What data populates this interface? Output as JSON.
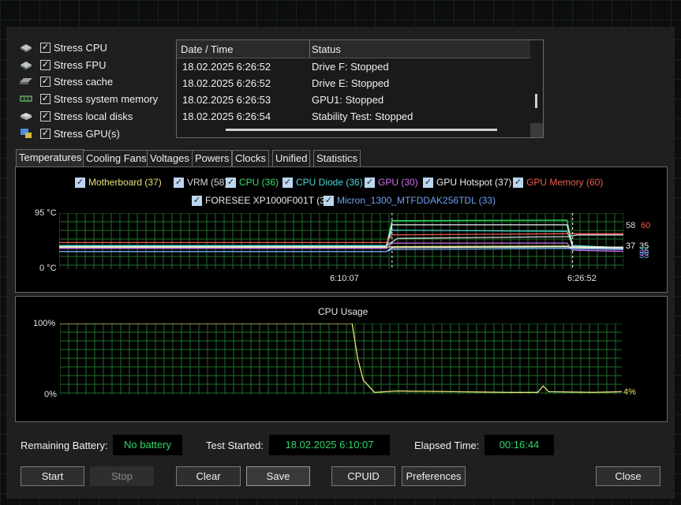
{
  "stress_options": [
    {
      "label": "Stress CPU",
      "checked": true,
      "icon": "cpu-icon"
    },
    {
      "label": "Stress FPU",
      "checked": true,
      "icon": "fpu-icon"
    },
    {
      "label": "Stress cache",
      "checked": true,
      "icon": "cache-icon"
    },
    {
      "label": "Stress system memory",
      "checked": true,
      "icon": "memory-icon"
    },
    {
      "label": "Stress local disks",
      "checked": true,
      "icon": "disk-icon"
    },
    {
      "label": "Stress GPU(s)",
      "checked": true,
      "icon": "gpu-icon"
    }
  ],
  "log": {
    "columns": [
      "Date / Time",
      "Status"
    ],
    "rows": [
      {
        "time": "18.02.2025 6:26:52",
        "status": "Drive F: Stopped"
      },
      {
        "time": "18.02.2025 6:26:52",
        "status": "Drive E: Stopped"
      },
      {
        "time": "18.02.2025 6:26:53",
        "status": "GPU1: Stopped"
      },
      {
        "time": "18.02.2025 6:26:54",
        "status": "Stability Test: Stopped"
      }
    ]
  },
  "tabs": [
    "Temperatures",
    "Cooling Fans",
    "Voltages",
    "Powers",
    "Clocks",
    "Unified",
    "Statistics"
  ],
  "temperature_legend": [
    {
      "label": "Motherboard (37)",
      "color": "#e8e27a"
    },
    {
      "label": "VRM (58)",
      "color": "#d9d9d9"
    },
    {
      "label": "CPU (36)",
      "color": "#33e06a"
    },
    {
      "label": "CPU Diode (36)",
      "color": "#4ad8d8"
    },
    {
      "label": "GPU (30)",
      "color": "#d070f0"
    },
    {
      "label": "GPU Hotspot (37)",
      "color": "#f0f0f0"
    },
    {
      "label": "GPU Memory (60)",
      "color": "#f05a50"
    },
    {
      "label": "FORESEE XP1000F001T (35)",
      "color": "#ececec"
    },
    {
      "label": "Micron_1300_MTFDDAK256TDL (33)",
      "color": "#6fa0f0"
    }
  ],
  "chart_data": [
    {
      "type": "line",
      "title": "",
      "ylabel": "",
      "ylim": [
        0,
        95
      ],
      "ytick_labels": [
        "95 °C",
        "0 °C"
      ],
      "xtick_labels": [
        "6:10:07",
        "6:26:52"
      ],
      "end_labels": [
        {
          "text": "58",
          "color": "#d9d9d9"
        },
        {
          "text": "60",
          "color": "#f05a50"
        },
        {
          "text": "37",
          "color": "#f0f0f0"
        },
        {
          "text": "35",
          "color": "#ececec"
        },
        {
          "text": "36",
          "color": "#4ad8d8"
        },
        {
          "text": "30",
          "color": "#d070f0"
        },
        {
          "text": "33",
          "color": "#6fa0f0"
        }
      ],
      "series": [
        {
          "name": "Motherboard",
          "color": "#e8e27a",
          "x": [
            0,
            0.58,
            0.59,
            0.9,
            0.91,
            1
          ],
          "y": [
            37,
            37,
            38,
            39,
            37,
            37
          ]
        },
        {
          "name": "VRM",
          "color": "#d9d9d9",
          "x": [
            0,
            0.58,
            0.6,
            0.9,
            0.92,
            1
          ],
          "y": [
            40,
            40,
            52,
            55,
            58,
            58
          ]
        },
        {
          "name": "CPU",
          "color": "#33e06a",
          "x": [
            0,
            0.58,
            0.59,
            0.9,
            0.91,
            1
          ],
          "y": [
            40,
            40,
            82,
            83,
            40,
            36
          ]
        },
        {
          "name": "CPU Diode",
          "color": "#4ad8d8",
          "x": [
            0,
            0.58,
            0.59,
            0.9,
            0.91,
            1
          ],
          "y": [
            40,
            40,
            66,
            64,
            40,
            36
          ]
        },
        {
          "name": "GPU",
          "color": "#d070f0",
          "x": [
            0,
            0.58,
            0.59,
            0.9,
            0.91,
            1
          ],
          "y": [
            35,
            35,
            44,
            44,
            32,
            30
          ]
        },
        {
          "name": "GPU Hotspot",
          "color": "#f0f0f0",
          "x": [
            0,
            0.58,
            0.59,
            0.9,
            0.91,
            1
          ],
          "y": [
            38,
            38,
            75,
            75,
            38,
            37
          ]
        },
        {
          "name": "GPU Memory",
          "color": "#f05a50",
          "x": [
            0,
            0.58,
            0.59,
            0.9,
            0.91,
            1
          ],
          "y": [
            45,
            45,
            58,
            60,
            60,
            60
          ]
        },
        {
          "name": "FORESEE XP1000F001T",
          "color": "#ececec",
          "x": [
            0,
            0.58,
            0.59,
            0.9,
            0.91,
            1
          ],
          "y": [
            30,
            30,
            36,
            38,
            36,
            35
          ]
        },
        {
          "name": "Micron_1300_MTFDDAK256TDL",
          "color": "#6fa0f0",
          "x": [
            0,
            0.58,
            0.59,
            0.9,
            0.91,
            1
          ],
          "y": [
            30,
            30,
            33,
            35,
            34,
            33
          ]
        }
      ]
    },
    {
      "type": "line",
      "title": "CPU Usage",
      "ylim": [
        0,
        100
      ],
      "ytick_labels": [
        "100%",
        "0%"
      ],
      "end_label": "4%",
      "series": [
        {
          "name": "CPU Usage",
          "color": "#e8e27a",
          "x": [
            0,
            0.52,
            0.53,
            0.54,
            0.56,
            0.6,
            0.7,
            0.8,
            0.85,
            0.86,
            0.87,
            0.95,
            1
          ],
          "y": [
            100,
            100,
            50,
            20,
            3,
            5,
            4,
            3,
            3,
            12,
            4,
            3,
            4
          ]
        }
      ]
    }
  ],
  "status": {
    "battery_label": "Remaining Battery:",
    "battery_value": "No battery",
    "started_label": "Test Started:",
    "started_value": "18.02.2025 6:10:07",
    "elapsed_label": "Elapsed Time:",
    "elapsed_value": "00:16:44"
  },
  "buttons": {
    "start": "Start",
    "stop": "Stop",
    "clear": "Clear",
    "save": "Save",
    "cpuid": "CPUID",
    "preferences": "Preferences",
    "close": "Close"
  }
}
